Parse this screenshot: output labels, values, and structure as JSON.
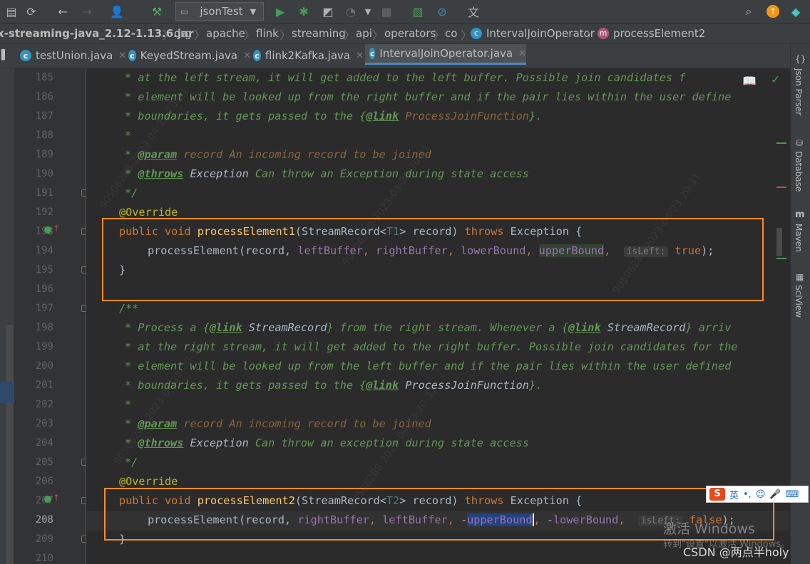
{
  "toolbar": {
    "run_config": "jsonTest"
  },
  "breadcrumb": [
    "x-streaming-java_2.12-1.13.6.jar",
    "org",
    "apache",
    "flink",
    "streaming",
    "api",
    "operators",
    "co",
    "IntervalJoinOperator",
    "processElement2"
  ],
  "tabs": [
    {
      "label": "testUnion.java",
      "active": false
    },
    {
      "label": "KeyedStream.java",
      "active": false
    },
    {
      "label": "flink2Kafka.java",
      "active": false
    },
    {
      "label": "IntervalJoinOperator.java",
      "active": true
    }
  ],
  "right_tools": [
    "Json Parser",
    "Database",
    "Maven",
    "SciView"
  ],
  "line_numbers": [
    "185",
    "186",
    "187",
    "188",
    "189",
    "190",
    "191",
    "192",
    "193",
    "194",
    "195",
    "196",
    "197",
    "198",
    "199",
    "200",
    "201",
    "202",
    "203",
    "204",
    "205",
    "206",
    "207",
    "208",
    "209",
    "210"
  ],
  "code": {
    "l185": "* at the left stream, it will get added to the left buffer. Possible join candidates f",
    "l186": "* element will be looked up from the right buffer and if the pair lies within the user define",
    "l187a": "* boundaries, it gets passed to the ",
    "l187b": "ProcessJoinFunction",
    "l188": "*",
    "l189a": "* ",
    "l189b": "@param",
    "l189c": " record An incoming record to be joined",
    "l190a": "* ",
    "l190b": "@throws",
    "l190c": " Exception",
    "l190d": " Can throw an Exception during state access",
    "l191": "*/",
    "l192": "@Override",
    "l193a": "public void ",
    "l193b": "processElement1",
    "l193c": "(StreamRecord<",
    "l193d": "T1",
    "l193e": "> record) ",
    "l193f": "throws",
    "l193g": " Exception {",
    "l194a": "processElement(record, ",
    "l194b": "leftBuffer",
    "l194c": "rightBuffer",
    "l194d": "lowerBound",
    "l194e": "upperBound",
    "l194f": "isLeft:",
    "l194g": "true",
    "l195": "}",
    "l197": "/**",
    "l198a": "* Process a ",
    "l198b": "StreamRecord",
    "l198c": " from the right stream. Whenever a ",
    "l198d": "StreamRecord",
    "l198e": " arriv",
    "l199": "* at the right stream, it will get added to the right buffer. Possible join candidates for the",
    "l200": "* element will be looked up from the left buffer and if the pair lies within the user defined",
    "l201a": "* boundaries, it gets passed to the ",
    "l201b": "ProcessJoinFunction",
    "l202": "*",
    "l203a": "* ",
    "l203b": "@param",
    "l203c": " record An incoming record to be joined",
    "l204a": "* ",
    "l204b": "@throws",
    "l204c": " Exception",
    "l204d": " Can throw an exception during state access",
    "l205": "*/",
    "l206": "@Override",
    "l207b": "processElement2",
    "l207d": "T2",
    "l208a": "processElement(record, ",
    "l208b": "rightBuffer",
    "l208c": "leftBuffer",
    "l208d": "upperBound",
    "l208e": "lowerBound",
    "l208f": "isLeft:",
    "l208g": "false",
    "l209": "}",
    "link_tag": "@link"
  },
  "watermark_text": "90506288-2023-04-23-20-31",
  "ime": {
    "label": "英"
  },
  "overlay": {
    "activate": "激活 Windows",
    "activate_sub": "转到\"设置\"以激活 Windows。",
    "csdn": "CSDN @两点半holy"
  },
  "colors": {
    "highlight_box": "#ff8c2a",
    "active_tab_underline": "#4a88c7"
  }
}
